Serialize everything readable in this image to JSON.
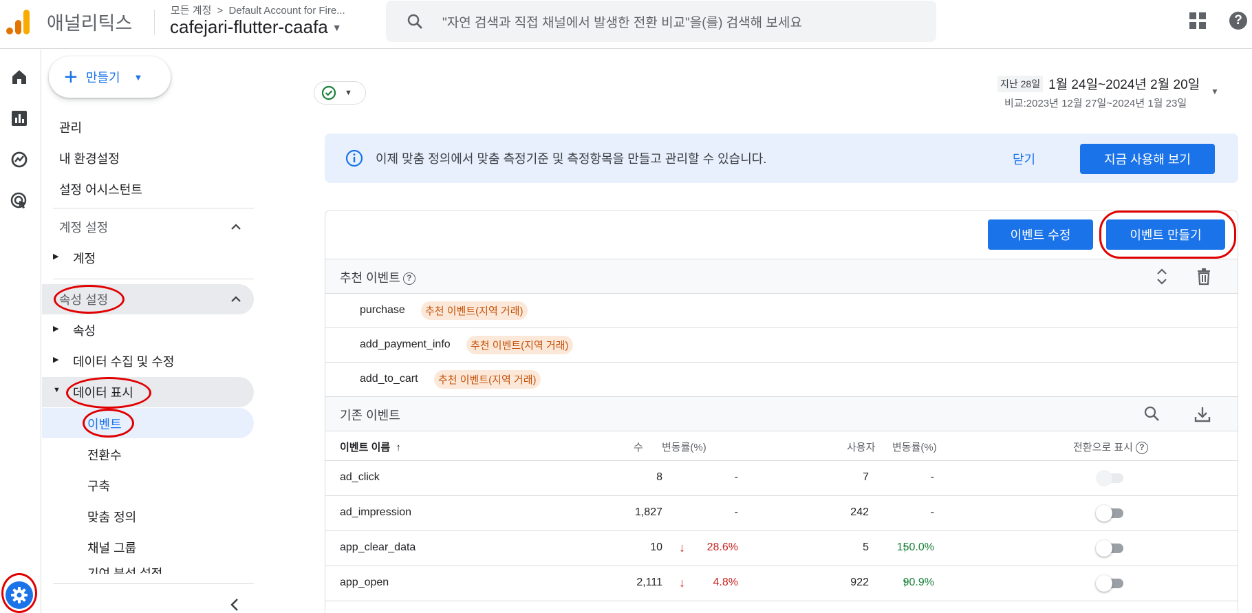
{
  "header": {
    "app_name": "애널리틱스",
    "breadcrumb_root": "모든 계정",
    "breadcrumb_sep": ">",
    "breadcrumb_account": "Default Account for Fire...",
    "property_name": "cafejari-flutter-caafa",
    "search_placeholder": "\"자연 검색과 직접 채널에서 발생한 전환 비교\"을(를) 검색해 보세요",
    "help_label": "?"
  },
  "rail": {
    "items": [
      "home-icon",
      "reports-icon",
      "explore-icon",
      "advertising-icon"
    ],
    "admin_icon": "gear-icon"
  },
  "nav": {
    "create_label": "만들기",
    "admin": "관리",
    "preferences": "내 환경설정",
    "setup_assistant": "설정 어시스턴트",
    "account_settings": "계정 설정",
    "account": "계정",
    "property_settings": "속성 설정",
    "property": "속성",
    "data_collection": "데이터 수집 및 수정",
    "data_display": "데이터 표시",
    "events": "이벤트",
    "conversions": "전환수",
    "audiences": "구축",
    "custom_definitions": "맞춤 정의",
    "channel_groups": "채널 그룹",
    "attribution_settings": "기여 분석 설정"
  },
  "date": {
    "period": "지난 28일",
    "range": "1월 24일~2024년 2월 20일",
    "compare": "비교:2023년 12월 27일~2024년 1월 23일"
  },
  "banner": {
    "message": "이제 맞춤 정의에서 맞춤 측정기준 및 측정항목을 만들고 관리할 수 있습니다.",
    "close_label": "닫기",
    "try_label": "지금 사용해 보기"
  },
  "card": {
    "edit_event_label": "이벤트 수정",
    "create_event_label": "이벤트 만들기",
    "recommended_title": "추천 이벤트",
    "recommended": [
      {
        "name": "purchase",
        "tag": "추천 이벤트(지역 거래)"
      },
      {
        "name": "add_payment_info",
        "tag": "추천 이벤트(지역 거래)"
      },
      {
        "name": "add_to_cart",
        "tag": "추천 이벤트(지역 거래)"
      }
    ],
    "existing_title": "기존 이벤트",
    "columns": {
      "event_name": "이벤트 이름",
      "count": "수",
      "count_change": "변동률(%)",
      "users": "사용자",
      "users_change": "변동률(%)",
      "mark_conversion": "전환으로 표시"
    },
    "rows": [
      {
        "name": "ad_click",
        "count": "8",
        "count_change": "-",
        "count_dir": "none",
        "users": "7",
        "users_change": "-",
        "users_dir": "none",
        "toggle": "disabled"
      },
      {
        "name": "ad_impression",
        "count": "1,827",
        "count_change": "-",
        "count_dir": "none",
        "users": "242",
        "users_change": "-",
        "users_dir": "none",
        "toggle": "off"
      },
      {
        "name": "app_clear_data",
        "count": "10",
        "count_change": "28.6%",
        "count_dir": "down",
        "users": "5",
        "users_change": "150.0%",
        "users_dir": "up",
        "toggle": "off"
      },
      {
        "name": "app_open",
        "count": "2,111",
        "count_change": "4.8%",
        "count_dir": "down",
        "users": "922",
        "users_change": "90.9%",
        "users_dir": "up",
        "toggle": "off"
      }
    ]
  },
  "colors": {
    "accent": "#1a73e8",
    "annotation_red": "#e00000",
    "down": "#c5221f",
    "up": "#188038",
    "tag_bg": "#fce8d8",
    "tag_fg": "#c5520a"
  }
}
